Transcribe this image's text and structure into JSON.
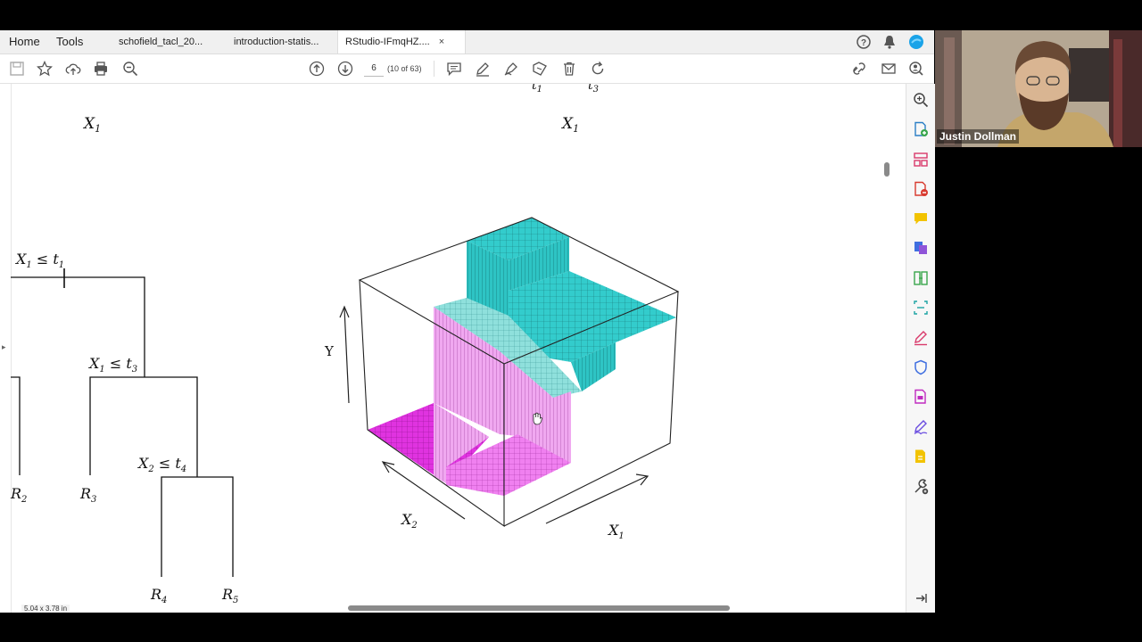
{
  "menu": {
    "home": "Home",
    "tools": "Tools"
  },
  "tabs": [
    {
      "label": "schofield_tacl_20..."
    },
    {
      "label": "introduction-statis..."
    },
    {
      "label": "RStudio-IFmqHZ....",
      "close": "×"
    }
  ],
  "toolbar": {
    "page_number": "6",
    "page_count": "(10 of 63)"
  },
  "status": {
    "page_size": "5.04 x 3.78 in"
  },
  "video": {
    "participant_name": "Justin Dollman"
  },
  "figure": {
    "top_labels": {
      "left_x1": "X",
      "left_x1_sub": "1",
      "right_x1": "X",
      "right_x1_sub": "1",
      "clipped_t1": "t",
      "clipped_t1_sub": "1",
      "clipped_t3": "t",
      "clipped_t3_sub": "3"
    },
    "tree": {
      "split1": {
        "var": "X",
        "var_sub": "1",
        "op": " ≤ ",
        "thr": "t",
        "thr_sub": "1"
      },
      "split2": {
        "var": "X",
        "var_sub": "1",
        "op": " ≤ ",
        "thr": "t",
        "thr_sub": "3"
      },
      "split3": {
        "var": "X",
        "var_sub": "2",
        "op": " ≤ ",
        "thr": "t",
        "thr_sub": "4"
      },
      "leaves": [
        {
          "name": "R",
          "sub": "2"
        },
        {
          "name": "R",
          "sub": "3"
        },
        {
          "name": "R",
          "sub": "4"
        },
        {
          "name": "R",
          "sub": "5"
        }
      ]
    },
    "surface": {
      "y_label": "Y",
      "x2_label": "X",
      "x2_sub": "2",
      "x1_label": "X",
      "x1_sub": "1",
      "colors": {
        "cyan": "#33cccc",
        "magenta": "#e033e0",
        "pink": "#f0a8f0"
      }
    }
  }
}
